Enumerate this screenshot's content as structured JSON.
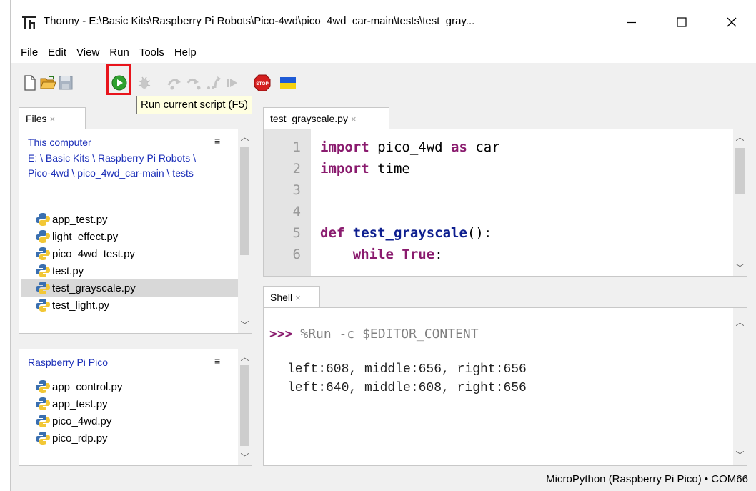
{
  "window": {
    "title": "Thonny  -  E:\\Basic Kits\\Raspberry Pi Robots\\Pico-4wd\\pico_4wd_car-main\\tests\\test_gray...",
    "minimize_glyph": "—",
    "maximize_glyph": "☐",
    "close_glyph": "✕"
  },
  "menu": [
    "File",
    "Edit",
    "View",
    "Run",
    "Tools",
    "Help"
  ],
  "toolbar": {
    "icons": [
      "new-file-icon",
      "open-file-icon",
      "save-icon",
      "run-icon",
      "debug-icon",
      "step-over-icon",
      "step-into-icon",
      "step-out-icon",
      "resume-icon",
      "stop-icon",
      "ukraine-flag-icon"
    ],
    "stop_label": "STOP",
    "tooltip": "Run current script (F5)",
    "highlight_color": "#e8141c"
  },
  "files": {
    "tab_label": "Files",
    "tab_close": "×",
    "computer": {
      "title": "This computer",
      "path": "E: \\ Basic Kits \\ Raspberry Pi Robots \\ Pico-4wd \\ pico_4wd_car-main \\ tests",
      "menu_glyph": "≡",
      "items": [
        "app_test.py",
        "light_effect.py",
        "pico_4wd_test.py",
        "test.py",
        "test_grayscale.py",
        "test_light.py"
      ],
      "selected": "test_grayscale.py"
    },
    "pico": {
      "title": "Raspberry Pi Pico",
      "menu_glyph": "≡",
      "items": [
        "app_control.py",
        "app_test.py",
        "pico_4wd.py",
        "pico_rdp.py"
      ]
    }
  },
  "editor": {
    "tab_label": "test_grayscale.py",
    "tab_close": "×",
    "lines": [
      {
        "n": "1",
        "tokens": [
          {
            "t": "import",
            "c": "kw"
          },
          {
            "t": " pico_4wd ",
            "c": ""
          },
          {
            "t": "as",
            "c": "kw"
          },
          {
            "t": " car",
            "c": ""
          }
        ]
      },
      {
        "n": "2",
        "tokens": [
          {
            "t": "import",
            "c": "kw"
          },
          {
            "t": " time",
            "c": ""
          }
        ]
      },
      {
        "n": "3",
        "tokens": []
      },
      {
        "n": "4",
        "tokens": []
      },
      {
        "n": "5",
        "tokens": [
          {
            "t": "def",
            "c": "kw"
          },
          {
            "t": " ",
            "c": ""
          },
          {
            "t": "test_grayscale",
            "c": "fn"
          },
          {
            "t": "():",
            "c": ""
          }
        ]
      },
      {
        "n": "6",
        "tokens": [
          {
            "t": "    ",
            "c": ""
          },
          {
            "t": "while",
            "c": "kw"
          },
          {
            "t": " ",
            "c": ""
          },
          {
            "t": "True",
            "c": "const"
          },
          {
            "t": ":",
            "c": ""
          }
        ]
      }
    ]
  },
  "shell": {
    "tab_label": "Shell",
    "tab_close": "×",
    "prompt": ">>>",
    "command": " %Run -c $EDITOR_CONTENT",
    "output": [
      "left:608, middle:656, right:656",
      "left:640, middle:608, right:656"
    ]
  },
  "status": {
    "text": "MicroPython (Raspberry Pi Pico)  •  COM66"
  },
  "colors": {
    "link_blue": "#1b2fb8",
    "keyword": "#8a1b6e",
    "function": "#0e1f8f",
    "gutter": "#e4e4e4",
    "selection": "#d8d8d8"
  }
}
